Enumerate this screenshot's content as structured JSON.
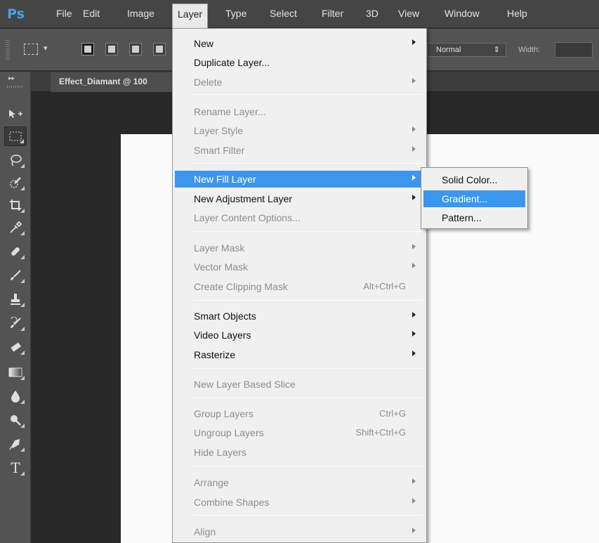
{
  "app": {
    "logo": "Ps"
  },
  "menubar": {
    "items": [
      "File",
      "Edit",
      "Image",
      "Layer",
      "Type",
      "Select",
      "Filter",
      "3D",
      "View",
      "Window",
      "Help"
    ],
    "active": "Layer"
  },
  "options_bar": {
    "blend_mode": "Normal",
    "width_label": "Width:",
    "width_value": ""
  },
  "document": {
    "tab_title": "Effect_Diamant @ 100"
  },
  "tools": [
    "move-tool",
    "marquee-tool",
    "lasso-tool",
    "quick-selection-tool",
    "crop-tool",
    "eyedropper-tool",
    "healing-brush-tool",
    "brush-tool",
    "clone-stamp-tool",
    "history-brush-tool",
    "eraser-tool",
    "gradient-tool",
    "blur-tool",
    "dodge-tool",
    "pen-tool",
    "type-tool"
  ],
  "layer_menu": {
    "items": [
      {
        "label": "New",
        "submenu": true
      },
      {
        "label": "Duplicate Layer..."
      },
      {
        "label": "Delete",
        "submenu": true,
        "disabled": true
      },
      {
        "label": "Rename Layer...",
        "disabled": true
      },
      {
        "label": "Layer Style",
        "submenu": true,
        "disabled": true
      },
      {
        "label": "Smart Filter",
        "submenu": true,
        "disabled": true
      },
      {
        "label": "New Fill Layer",
        "submenu": true,
        "highlighted": true
      },
      {
        "label": "New Adjustment Layer",
        "submenu": true
      },
      {
        "label": "Layer Content Options...",
        "disabled": true
      },
      {
        "label": "Layer Mask",
        "submenu": true,
        "disabled": true
      },
      {
        "label": "Vector Mask",
        "submenu": true,
        "disabled": true
      },
      {
        "label": "Create Clipping Mask",
        "shortcut": "Alt+Ctrl+G",
        "disabled": true
      },
      {
        "label": "Smart Objects",
        "submenu": true
      },
      {
        "label": "Video Layers",
        "submenu": true
      },
      {
        "label": "Rasterize",
        "submenu": true
      },
      {
        "label": "New Layer Based Slice",
        "disabled": true
      },
      {
        "label": "Group Layers",
        "shortcut": "Ctrl+G",
        "disabled": true
      },
      {
        "label": "Ungroup Layers",
        "shortcut": "Shift+Ctrl+G",
        "disabled": true
      },
      {
        "label": "Hide Layers",
        "disabled": true
      },
      {
        "label": "Arrange",
        "submenu": true,
        "disabled": true
      },
      {
        "label": "Combine Shapes",
        "submenu": true,
        "disabled": true
      },
      {
        "label": "Align",
        "submenu": true,
        "disabled": true
      }
    ]
  },
  "fill_layer_submenu": {
    "items": [
      {
        "label": "Solid Color..."
      },
      {
        "label": "Gradient...",
        "highlighted": true
      },
      {
        "label": "Pattern..."
      }
    ]
  },
  "colors": {
    "highlight": "#3c96ee",
    "ps_logo": "#4da3e0",
    "menubar": "#454545",
    "workspace": "#282828"
  }
}
